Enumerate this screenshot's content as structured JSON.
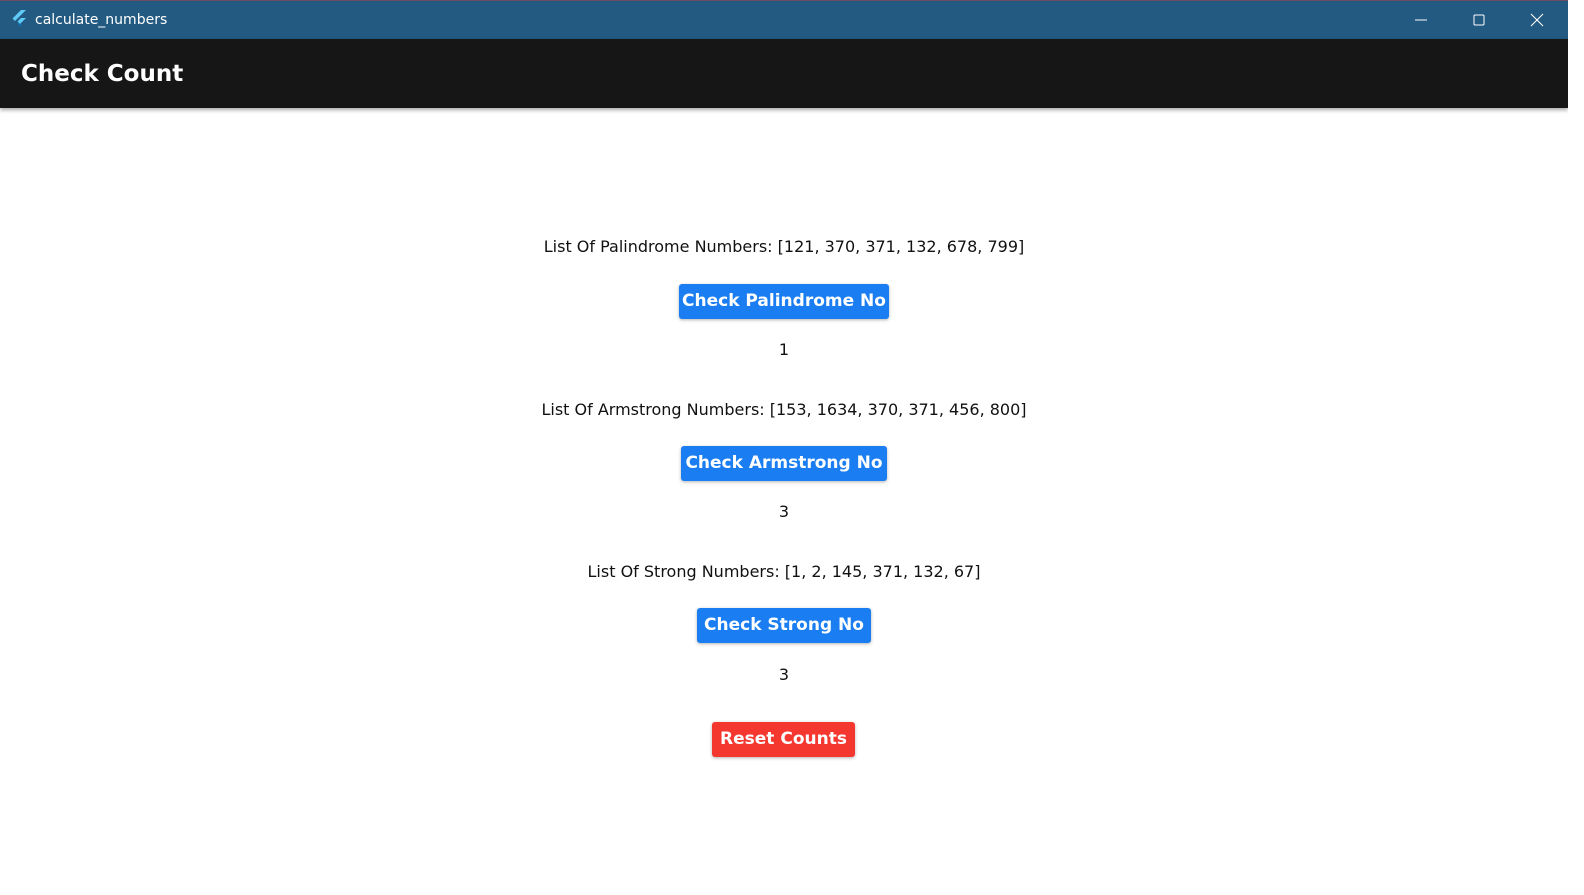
{
  "window": {
    "title": "calculate_numbers",
    "titlebar_color": "#235a81",
    "icon": "flutter-logo-icon",
    "controls": [
      "minimize-icon",
      "maximize-icon",
      "close-icon"
    ]
  },
  "appbar": {
    "title": "Check Count",
    "background": "#161616"
  },
  "sections": [
    {
      "list_label": "List Of Palindrome Numbers: [121, 370, 371, 132, 678, 799]",
      "button_label": "Check Palindrome No",
      "count": "1"
    },
    {
      "list_label": "List Of Armstrong Numbers: [153, 1634, 370, 371, 456, 800]",
      "button_label": "Check Armstrong No",
      "count": "3"
    },
    {
      "list_label": "List Of Strong Numbers: [1, 2, 145, 371, 132, 67]",
      "button_label": "Check Strong No",
      "count": "3"
    }
  ],
  "reset": {
    "button_label": "Reset Counts"
  },
  "colors": {
    "primary_button": "#1a7ef2",
    "reset_button": "#f4372f"
  }
}
